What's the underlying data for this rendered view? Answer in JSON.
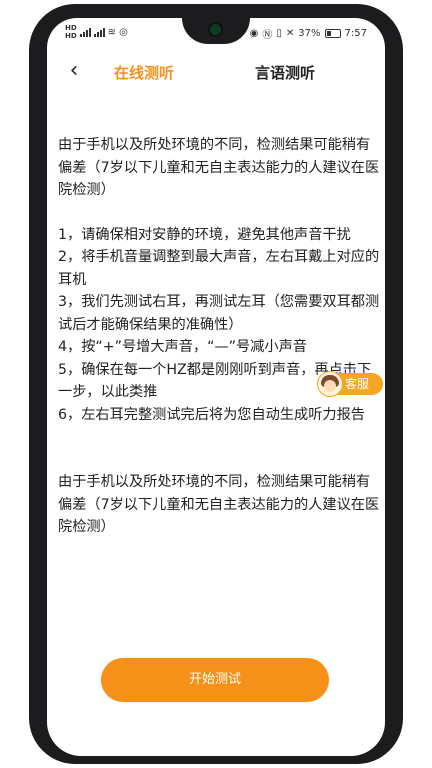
{
  "status_bar": {
    "left_text": "",
    "battery": "37%",
    "time": "7:57"
  },
  "nav": {
    "tab_online": "在线测听",
    "tab_speech": "言语测听"
  },
  "instructions": {
    "disclaimer_top": "由于手机以及所处环境的不同，检测结果可能稍有偏差（7岁以下儿童和无自主表达能力的人建议在医院检测）",
    "steps": [
      "1，请确保相对安静的环境，避免其他声音干扰",
      "2，将手机音量调整到最大声音，左右耳戴上对应的耳机",
      "3，我们先测试右耳，再测试左耳（您需要双耳都测试后才能确保结果的准确性）",
      "4，按“+”号增大声音，“—”号减小声音",
      "5，确保在每一个HZ都是刚刚听到声音，再点击下一步，以此类推",
      "6，左右耳完整测试完后将为您自动生成听力报告"
    ],
    "disclaimer_bottom": "由于手机以及所处环境的不同，检测结果可能稍有偏差（7岁以下儿童和无自主表达能力的人建议在医院检测）"
  },
  "customer_service": {
    "label": "客服"
  },
  "actions": {
    "start_label": "开始测试"
  },
  "colors": {
    "accent": "#f5921e",
    "button": "#f59018"
  }
}
